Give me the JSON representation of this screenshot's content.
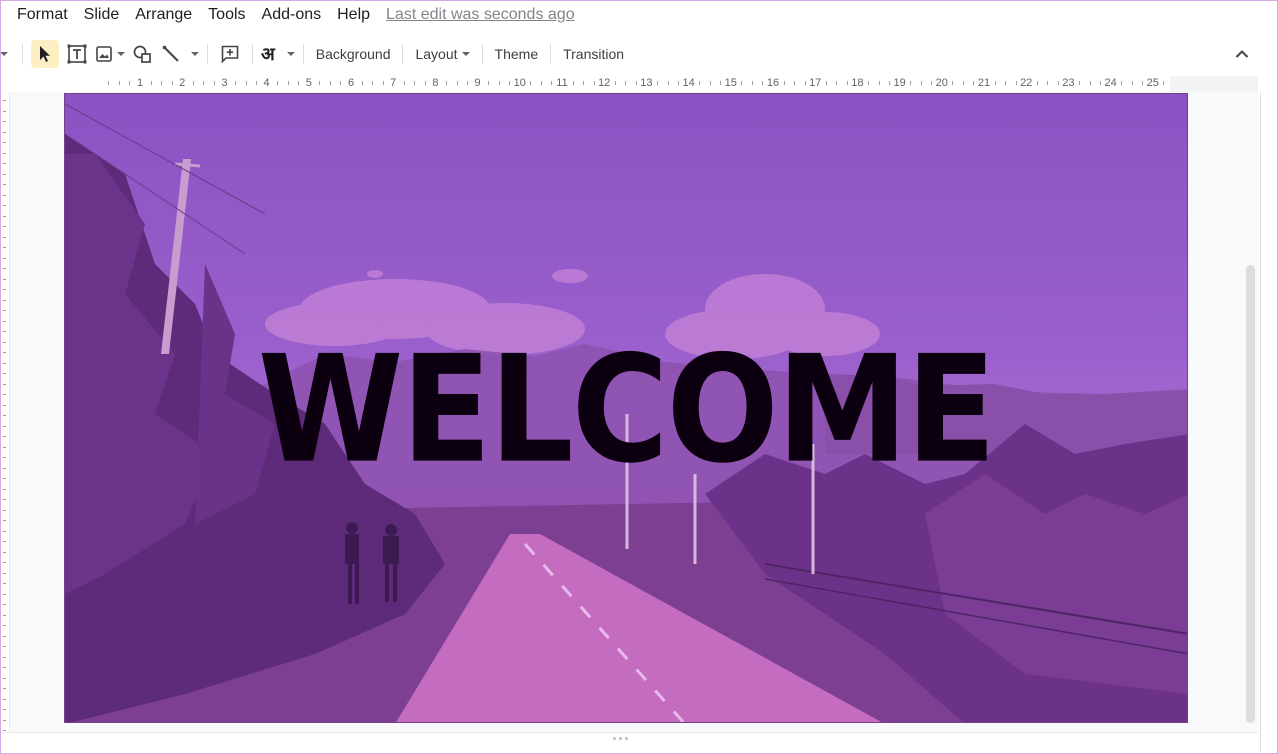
{
  "menu": {
    "items": [
      "Format",
      "Slide",
      "Arrange",
      "Tools",
      "Add-ons",
      "Help"
    ],
    "last_edit": "Last edit was seconds ago"
  },
  "toolbar": {
    "input_tools_glyph": "अ",
    "background_label": "Background",
    "layout_label": "Layout",
    "theme_label": "Theme",
    "transition_label": "Transition",
    "icons": [
      "select-icon",
      "text-box-icon",
      "image-icon",
      "shape-icon",
      "line-icon",
      "comment-icon",
      "input-tools-icon",
      "collapse-icon"
    ]
  },
  "ruler": {
    "numbers": [
      "1",
      "2",
      "3",
      "4",
      "5",
      "6",
      "7",
      "8",
      "9",
      "10",
      "11",
      "12",
      "13",
      "14",
      "15",
      "16",
      "17",
      "18",
      "19",
      "20",
      "21",
      "22",
      "23",
      "24",
      "25"
    ]
  },
  "slide": {
    "title": "WELCOME",
    "overlay_color": "#9b5cc9",
    "title_color": "#0c0010"
  },
  "colors": {
    "active_tool_bg": "#feefc3",
    "canvas_bg": "#f8f9fa"
  }
}
